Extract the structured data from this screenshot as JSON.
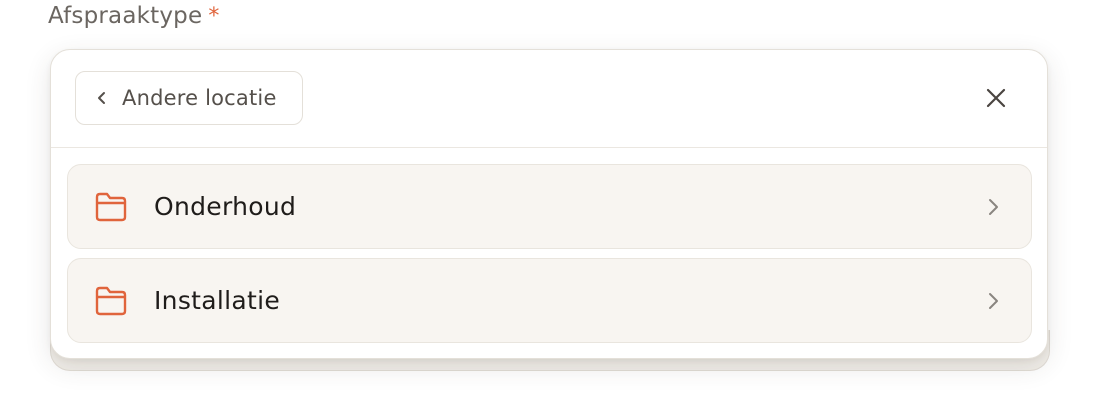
{
  "field": {
    "label": "Afspraaktype",
    "required_mark": "*"
  },
  "panel": {
    "back_button_label": "Andere locatie",
    "back_icon": "chevron-left-icon",
    "close_icon": "close-icon",
    "items": [
      {
        "label": "Onderhoud",
        "icon": "folder-icon"
      },
      {
        "label": "Installatie",
        "icon": "folder-icon"
      }
    ]
  },
  "colors": {
    "accent": "#e0643c",
    "item_background": "#f8f5f1",
    "text_primary": "#1f1c1a",
    "text_muted": "#6b6661"
  }
}
